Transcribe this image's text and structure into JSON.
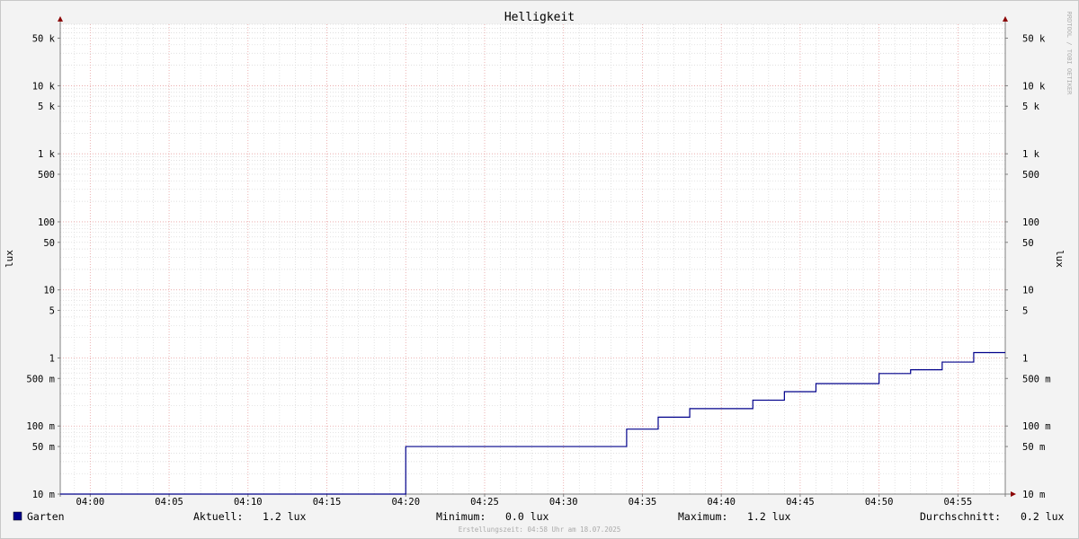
{
  "chart_data": {
    "type": "line",
    "title": "Helligkeit",
    "ylabel": "lux",
    "ylabel_right": "lux",
    "watermark": "RRDTOOL / TOBI OETIKER",
    "yscale": "log",
    "ylim": [
      0.01,
      80000
    ],
    "xlim_minutes": [
      -1.9,
      58.0
    ],
    "y_ticks": [
      {
        "value": 50000,
        "label": "50 k"
      },
      {
        "value": 10000,
        "label": "10 k"
      },
      {
        "value": 5000,
        "label": "5 k"
      },
      {
        "value": 1000,
        "label": "1 k"
      },
      {
        "value": 500,
        "label": "500"
      },
      {
        "value": 100,
        "label": "100"
      },
      {
        "value": 50,
        "label": "50"
      },
      {
        "value": 10,
        "label": "10"
      },
      {
        "value": 5,
        "label": "5"
      },
      {
        "value": 1,
        "label": "1"
      },
      {
        "value": 0.5,
        "label": "500 m"
      },
      {
        "value": 0.1,
        "label": "100 m"
      },
      {
        "value": 0.05,
        "label": "50 m"
      },
      {
        "value": 0.01,
        "label": "10 m"
      }
    ],
    "x_ticks": [
      {
        "minute": 0,
        "label": "04:00"
      },
      {
        "minute": 5,
        "label": "04:05"
      },
      {
        "minute": 10,
        "label": "04:10"
      },
      {
        "minute": 15,
        "label": "04:15"
      },
      {
        "minute": 20,
        "label": "04:20"
      },
      {
        "minute": 25,
        "label": "04:25"
      },
      {
        "minute": 30,
        "label": "04:30"
      },
      {
        "minute": 35,
        "label": "04:35"
      },
      {
        "minute": 40,
        "label": "04:40"
      },
      {
        "minute": 45,
        "label": "04:45"
      },
      {
        "minute": 50,
        "label": "04:50"
      },
      {
        "minute": 55,
        "label": "04:55"
      }
    ],
    "series": [
      {
        "name": "Garten",
        "color": "#00008b",
        "steps": [
          {
            "minute": -1.9,
            "value": 0.0
          },
          {
            "minute": 20.0,
            "value": 0.05
          },
          {
            "minute": 34.0,
            "value": 0.09
          },
          {
            "minute": 36.0,
            "value": 0.135
          },
          {
            "minute": 38.0,
            "value": 0.18
          },
          {
            "minute": 42.0,
            "value": 0.24
          },
          {
            "minute": 44.0,
            "value": 0.32
          },
          {
            "minute": 46.0,
            "value": 0.42
          },
          {
            "minute": 50.0,
            "value": 0.59
          },
          {
            "minute": 52.0,
            "value": 0.67
          },
          {
            "minute": 54.0,
            "value": 0.87
          },
          {
            "minute": 56.0,
            "value": 1.2
          }
        ]
      }
    ]
  },
  "legend": {
    "series_name": "Garten",
    "swatch_color": "#00008b",
    "stats": [
      {
        "label": "Aktuell:",
        "value": "1.2 lux"
      },
      {
        "label": "Minimum:",
        "value": "0.0 lux"
      },
      {
        "label": "Maximum:",
        "value": "1.2 lux"
      },
      {
        "label": "Durchschnitt:",
        "value": "0.2 lux"
      }
    ]
  },
  "footer": "Erstellungszeit: 04:58 Uhr am 18.07.2025",
  "colors": {
    "background": "#f3f3f3",
    "canvas": "#ffffff",
    "major_grid": "#e8a0a0",
    "minor_grid": "#d6d6d6",
    "axis": "#808080",
    "arrow": "#8b0000"
  }
}
